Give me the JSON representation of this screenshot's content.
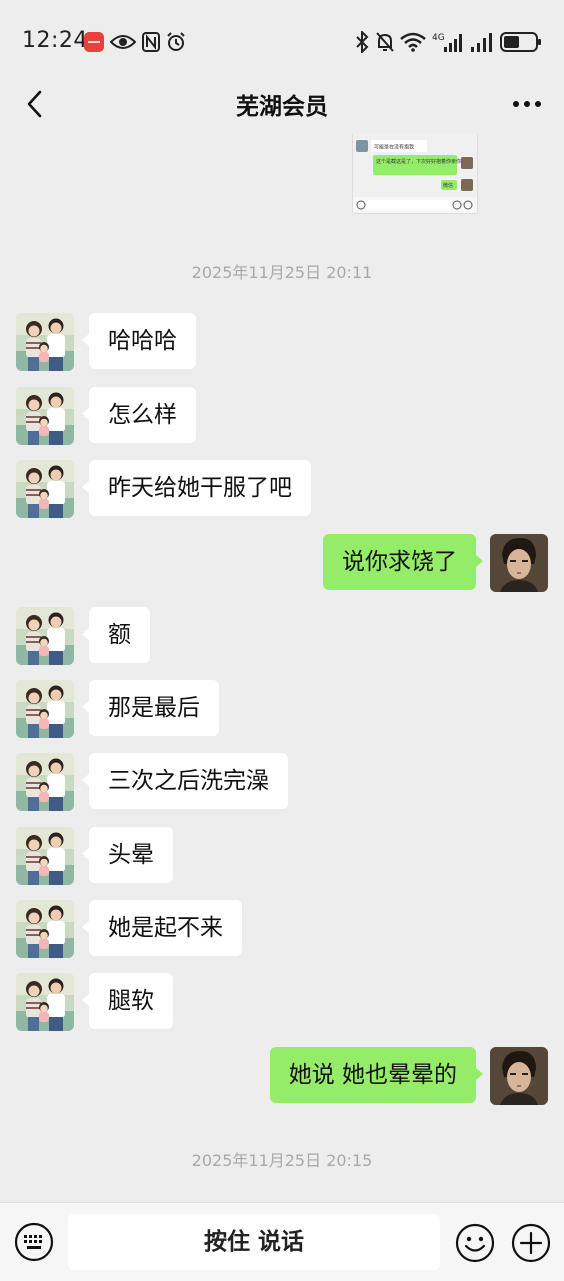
{
  "status_bar": {
    "time": "12:24",
    "network": "4G",
    "icons": [
      "huawei-app-icon",
      "eye-icon",
      "nfc-icon",
      "alarm-icon",
      "bluetooth-icon",
      "mute-bell-icon",
      "wifi-icon",
      "signal-4g-icon",
      "signal-icon",
      "battery-icon"
    ]
  },
  "header": {
    "title": "芜湖会员",
    "back_icon": "chevron-left-icon",
    "more_icon": "more-dots-icon"
  },
  "shared_screenshot": {
    "line1": "可能是在没有抱我",
    "line2": "这个是截这是了，下次好好抱着你亲你",
    "line3": "微信"
  },
  "timestamps": [
    "2025年11月25日 20:11",
    "2025年11月25日 20:15"
  ],
  "messages": [
    {
      "side": "in",
      "text": "哈哈哈"
    },
    {
      "side": "in",
      "text": "怎么样"
    },
    {
      "side": "in",
      "text": "昨天给她干服了吧"
    },
    {
      "side": "out",
      "text": "说你求饶了"
    },
    {
      "side": "in",
      "text": "额"
    },
    {
      "side": "in",
      "text": "那是最后"
    },
    {
      "side": "in",
      "text": "三次之后洗完澡"
    },
    {
      "side": "in",
      "text": "头晕"
    },
    {
      "side": "in",
      "text": "她是起不来"
    },
    {
      "side": "in",
      "text": "腿软"
    },
    {
      "side": "out",
      "text": "她说 她也晕晕的"
    }
  ],
  "input_bar": {
    "hold_to_talk": "按住 说话",
    "keyboard_icon": "keyboard-icon",
    "emoji_icon": "emoji-icon",
    "plus_icon": "plus-icon"
  },
  "colors": {
    "background": "#ededed",
    "incoming_bubble": "#ffffff",
    "outgoing_bubble": "#95ec69",
    "timestamp": "#a9a9a9"
  }
}
